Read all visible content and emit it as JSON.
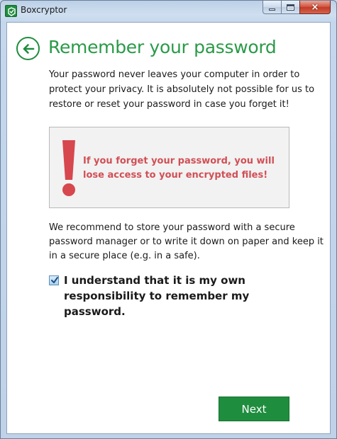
{
  "window": {
    "title": "Boxcryptor",
    "app_icon": "boxcryptor-logo-icon",
    "controls": {
      "minimize": "minimize-icon",
      "maximize": "maximize-icon",
      "close": "×"
    }
  },
  "header": {
    "back_icon": "back-arrow-icon",
    "title": "Remember your password"
  },
  "content": {
    "intro": "Your password never leaves your computer in order to protect your privacy. It is absolutely not possible for us to restore or reset your password in case you forget it!",
    "warning": {
      "icon": "exclamation-icon",
      "text": "If you forget your password, you will lose access to your encrypted files!"
    },
    "recommendation": "We recommend to store your password with a secure password manager or to write it down on paper and keep it in a secure place (e.g. in a safe).",
    "acknowledge": {
      "checked": true,
      "label": "I understand that it is my own responsibility to remember my password."
    }
  },
  "footer": {
    "next_label": "Next"
  },
  "colors": {
    "accent": "#1f8d3e",
    "title": "#2a9a48",
    "warning": "#d14f55"
  }
}
